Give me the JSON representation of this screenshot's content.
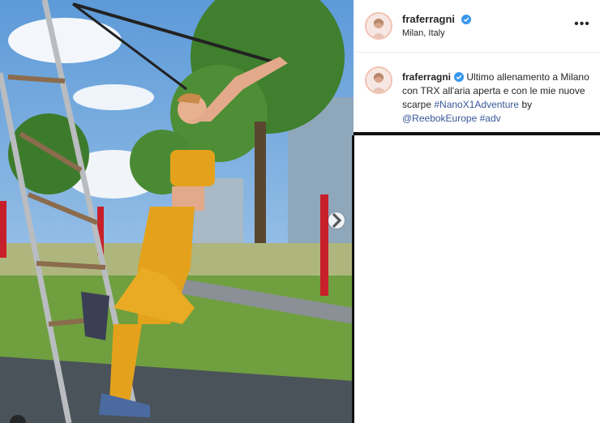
{
  "post": {
    "image_alt": "",
    "next_icon": "chevron-right-icon"
  },
  "header": {
    "username": "fraferragni",
    "location": "Milan, Italy",
    "more_icon": "more-options-icon",
    "more_label": "•••"
  },
  "caption": {
    "username": "fraferragni",
    "text_before": " Ultimo allenamento a Milano con TRX all'aria aperta e con le mie nuove scarpe ",
    "hashtag1": "#NanoX1Adventure",
    "by": " by ",
    "mention": "@ReebokEurope",
    "space": " ",
    "hashtag2": "#adv"
  },
  "colors": {
    "link": "#385898",
    "verified": "#3897f0",
    "text": "#262626"
  }
}
